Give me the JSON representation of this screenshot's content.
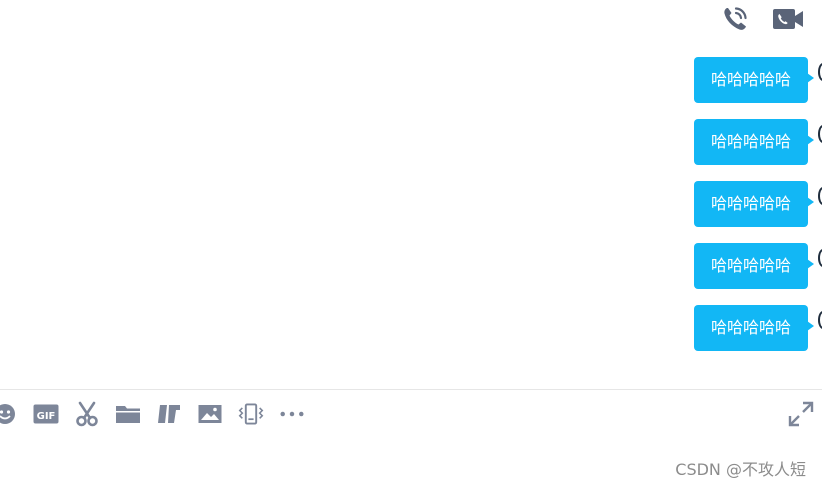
{
  "header": {
    "icons": [
      "phone-call-icon",
      "video-call-icon"
    ]
  },
  "messages": [
    {
      "text": "哈哈哈哈哈",
      "side": "right"
    },
    {
      "text": "哈哈哈哈哈",
      "side": "right"
    },
    {
      "text": "哈哈哈哈哈",
      "side": "right"
    },
    {
      "text": "哈哈哈哈哈",
      "side": "right"
    },
    {
      "text": "哈哈哈哈哈",
      "side": "right"
    }
  ],
  "toolbar": {
    "icons": [
      "emoji-icon",
      "gif-icon",
      "scissors-icon",
      "folder-icon",
      "document-icon",
      "image-icon",
      "shake-icon",
      "more-icon",
      "expand-icon"
    ],
    "gif_label": "GIF"
  },
  "colors": {
    "bubble": "#12b7f5",
    "icon": "#5a6478",
    "toolbar_icon": "#7d8699"
  },
  "watermark": "CSDN @不攻人短"
}
